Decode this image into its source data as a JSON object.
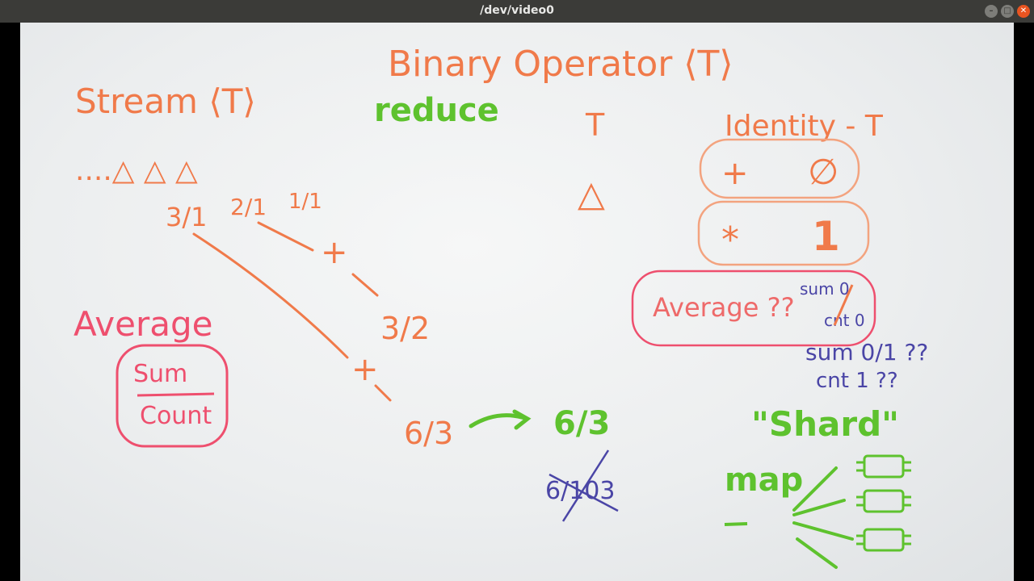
{
  "window": {
    "title": "/dev/video0",
    "controls": {
      "minimize": "–",
      "maximize": "□",
      "close": "✕"
    }
  },
  "board": {
    "heading": "Binary Operator ⟨T⟩",
    "stream_label": "Stream ⟨T⟩",
    "stream_items": "....△ △ △",
    "reduce_label": "reduce",
    "t_label": "T",
    "triangle": "△",
    "identity_label": "Identity - T",
    "identity_rows": [
      {
        "op": "+",
        "value": "∅"
      },
      {
        "op": "*",
        "value": "1"
      }
    ],
    "average_box": {
      "text": "Average ??",
      "note_top": "sum 0",
      "note_bottom": "cnt 0"
    },
    "question_note": {
      "line1": "sum 0/1 ??",
      "line2": "cnt 1 ??"
    },
    "fractions": {
      "a": "3/1",
      "b": "2/1",
      "c": "1/1",
      "mid": "3/2",
      "result": "6/3",
      "copy": "6/3",
      "struck": "6/103"
    },
    "plus": "+",
    "average_label": "Average",
    "sum": "Sum",
    "count": "Count",
    "shard_label": "\"Shard\"",
    "map_label": "map",
    "colors": {
      "orange": "#f07a4a",
      "green": "#5ec22e",
      "pink": "#ee4f6e",
      "blue": "#4a45a6"
    }
  }
}
